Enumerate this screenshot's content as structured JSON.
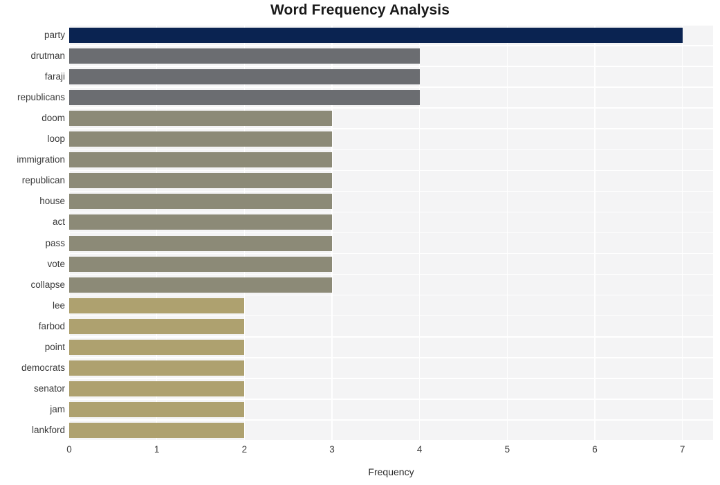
{
  "chart_data": {
    "type": "bar",
    "orientation": "horizontal",
    "title": "Word Frequency Analysis",
    "xlabel": "Frequency",
    "ylabel": "",
    "xlim": [
      0,
      7.35
    ],
    "xticks": [
      0,
      1,
      2,
      3,
      4,
      5,
      6,
      7
    ],
    "xtick_labels": [
      "0",
      "1",
      "2",
      "3",
      "4",
      "5",
      "6",
      "7"
    ],
    "grid": true,
    "grid_color": "#ffffff",
    "plot_background": "#f4f4f5",
    "legend": null,
    "categories": [
      "party",
      "drutman",
      "faraji",
      "republicans",
      "doom",
      "loop",
      "immigration",
      "republican",
      "house",
      "act",
      "pass",
      "vote",
      "collapse",
      "lee",
      "farbod",
      "point",
      "democrats",
      "senator",
      "jam",
      "lankford"
    ],
    "values": [
      7,
      4,
      4,
      4,
      3,
      3,
      3,
      3,
      3,
      3,
      3,
      3,
      3,
      2,
      2,
      2,
      2,
      2,
      2,
      2
    ],
    "bar_colors": [
      "#0a2351",
      "#6b6d71",
      "#6b6d71",
      "#6b6d71",
      "#8c8a77",
      "#8c8a77",
      "#8c8a77",
      "#8c8a77",
      "#8c8a77",
      "#8c8a77",
      "#8c8a77",
      "#8c8a77",
      "#8c8a77",
      "#aea16f",
      "#aea16f",
      "#aea16f",
      "#aea16f",
      "#aea16f",
      "#aea16f",
      "#aea16f"
    ]
  }
}
